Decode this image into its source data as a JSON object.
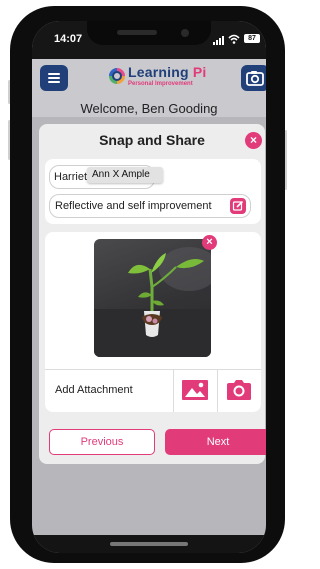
{
  "status_bar": {
    "time": "14:07",
    "battery": "87"
  },
  "header": {
    "logo_text": "Learning",
    "logo_pi": "Pi",
    "logo_subtitle": "Personal Improvement",
    "welcome": "Welcome, Ben Gooding"
  },
  "card": {
    "title": "Snap and Share",
    "learner_name": "Harriet",
    "tooltip_text": "Ann X Ample",
    "category": "Reflective and self improvement",
    "add_attachment_label": "Add Attachment",
    "previous_label": "Previous",
    "next_label": "Next"
  },
  "colors": {
    "brand_navy": "#21407a",
    "accent_pink": "#e23b7a"
  },
  "icons": [
    "menu-icon",
    "camera-icon",
    "close-icon",
    "edit-icon",
    "gallery-icon"
  ]
}
